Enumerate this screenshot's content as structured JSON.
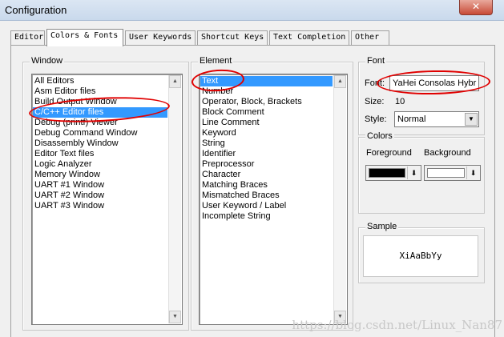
{
  "window": {
    "title": "Configuration",
    "close_glyph": "✕"
  },
  "tabs": [
    "Editor",
    "Colors & Fonts",
    "User Keywords",
    "Shortcut Keys",
    "Text Completion",
    "Other"
  ],
  "active_tab": "Colors & Fonts",
  "window_group": {
    "label": "Window",
    "items": [
      "All Editors",
      "Asm Editor files",
      "Build Output Window",
      "C/C++ Editor files",
      "Debug (printf) Viewer",
      "Debug Command Window",
      "Disassembly Window",
      "Editor Text files",
      "Logic Analyzer",
      "Memory Window",
      "UART #1 Window",
      "UART #2 Window",
      "UART #3 Window"
    ],
    "selected": "C/C++ Editor files"
  },
  "element_group": {
    "label": "Element",
    "items": [
      "Text",
      "Number",
      "Operator, Block, Brackets",
      "Block Comment",
      "Line Comment",
      "Keyword",
      "String",
      "Identifier",
      "Preprocessor",
      "Character",
      "Matching Braces",
      "Mismatched Braces",
      "User Keyword / Label",
      "Incomplete String"
    ],
    "selected": "Text"
  },
  "font_group": {
    "label": "Font",
    "font_label": "Font:",
    "font_value": "YaHei Consolas Hybr",
    "size_label": "Size:",
    "size_value": "10",
    "style_label": "Style:",
    "style_value": "Normal"
  },
  "colors_group": {
    "label": "Colors",
    "foreground_label": "Foreground",
    "background_label": "Background",
    "foreground_color": "#000000",
    "background_color": "#ffffff"
  },
  "sample_group": {
    "label": "Sample",
    "text": "XiAaBbYy"
  },
  "watermark": "https://blog.csdn.net/Linux_Nan87",
  "icons": {
    "scroll_up": "▲",
    "scroll_down": "▼",
    "dropdown": "▼",
    "color_dropdown": "⬇"
  }
}
